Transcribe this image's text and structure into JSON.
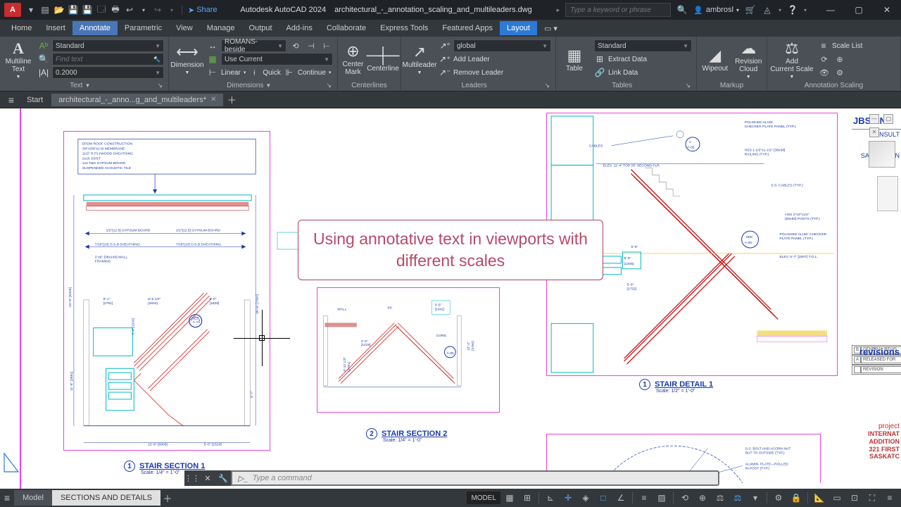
{
  "title": {
    "app": "Autodesk AutoCAD 2024",
    "file": "architectural_-_annotation_scaling_and_multileaders.dwg",
    "share": "Share",
    "search_placeholder": "Type a keyword or phrase",
    "user": "ambrosl"
  },
  "menu": {
    "tabs": [
      "Home",
      "Insert",
      "Annotate",
      "Parametric",
      "View",
      "Manage",
      "Output",
      "Add-ins",
      "Collaborate",
      "Express Tools",
      "Featured Apps",
      "Layout"
    ],
    "active": "Annotate",
    "layout_active": "Layout"
  },
  "ribbon": {
    "text": {
      "label": "Text",
      "big": "Multiline\nText",
      "style": "Standard",
      "find_placeholder": "Find text",
      "height": "0.2000"
    },
    "dimensions": {
      "label": "Dimensions",
      "big": "Dimension",
      "style": "ROMANS-beside",
      "use_current": "Use Current",
      "linear": "Linear",
      "quick": "Quick",
      "continue": "Continue"
    },
    "centerlines": {
      "label": "Centerlines",
      "mark": "Center\nMark",
      "line": "Centerline"
    },
    "leaders": {
      "label": "Leaders",
      "big": "Multileader",
      "style": "global",
      "add": "Add Leader",
      "remove": "Remove Leader"
    },
    "tables": {
      "label": "Tables",
      "big": "Table",
      "style": "Standard",
      "extract": "Extract Data",
      "link": "Link Data"
    },
    "markup": {
      "label": "Markup",
      "wipeout": "Wipeout",
      "cloud": "Revision\nCloud"
    },
    "scaling": {
      "label": "Annotation Scaling",
      "add": "Add\nCurrent Scale",
      "list": "Scale List"
    }
  },
  "doc_tabs": {
    "start": "Start",
    "active": "architectural_-_anno...g_and_multileaders*"
  },
  "callout": "Using annotative text in viewports with different scales",
  "viewports": {
    "vp1_title": "STAIR SECTION 1",
    "vp1_scale": "Scale: 1/4\" = 1'-0\"",
    "vp2_title": "STAIR SECTION 2",
    "vp2_scale": "Scale: 1/4\" = 1'-0\"",
    "vp3_title": "STAIR DETAIL 1",
    "vp3_scale": "Scale: 1/2\" = 1'-0\""
  },
  "titleblock": {
    "firm_a": "JBS",
    "firm_b": "ENG",
    "consult": "CONSULT",
    "city": "SASKATOON",
    "rev_b": "GENERAL REVIS",
    "rev_a": "RELEASED FOR",
    "rev_lbl": "REVISION",
    "revisions": "revisions",
    "project": "project",
    "p1": "INTERNAT",
    "p2": "ADDITION",
    "p3": "321 FIRST",
    "p4": "SASKATC"
  },
  "cmdline": {
    "placeholder": "Type a command"
  },
  "status": {
    "model": "Model",
    "layout": "SECTIONS AND DETAILS",
    "space": "MODEL"
  }
}
